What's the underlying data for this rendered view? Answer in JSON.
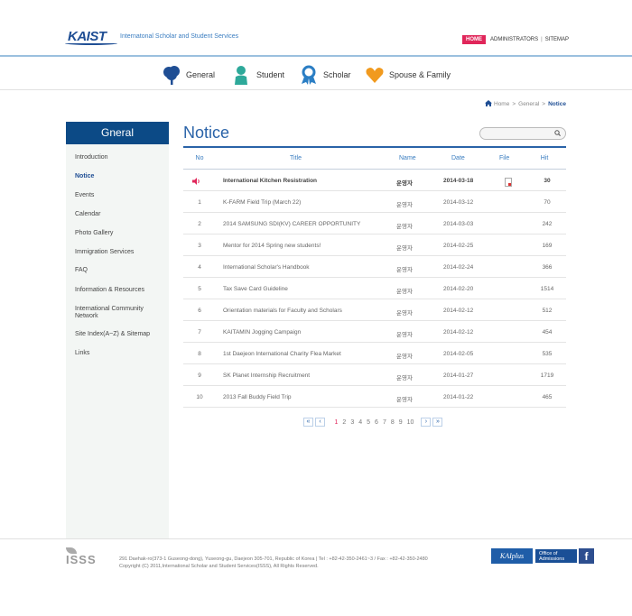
{
  "header": {
    "logo_text": "KAIST",
    "site_name": "Internatonal Scholar and Student Services",
    "home_label": "HOME",
    "administrators_label": "ADMINISTRATORS",
    "sitemap_label": "SITEMAP"
  },
  "nav": {
    "items": [
      {
        "label": "General",
        "icon": "tree-icon",
        "color": "#1f4e94"
      },
      {
        "label": "Student",
        "icon": "person-icon",
        "color": "#2ea99a"
      },
      {
        "label": "Scholar",
        "icon": "award-ribbon-icon",
        "color": "#2b7ec4"
      },
      {
        "label": "Spouse & Family",
        "icon": "heart-icon",
        "color": "#f19a1e"
      }
    ]
  },
  "breadcrumb": {
    "home": "Home",
    "section": "General",
    "current": "Notice"
  },
  "sidebar": {
    "title": "Gneral",
    "items": [
      {
        "label": "Introduction"
      },
      {
        "label": "Notice"
      },
      {
        "label": "Events"
      },
      {
        "label": "Calendar"
      },
      {
        "label": "Photo Gallery"
      },
      {
        "label": "Immigration Services"
      },
      {
        "label": "FAQ"
      },
      {
        "label": "Information & Resources"
      },
      {
        "label": "International Community Network"
      },
      {
        "label": "Site Index(A~Z) & Sitemap"
      },
      {
        "label": "Links"
      }
    ]
  },
  "main": {
    "title": "Notice",
    "columns": {
      "no": "No",
      "title": "Title",
      "name": "Name",
      "date": "Date",
      "file": "File",
      "hit": "Hit"
    },
    "rows": [
      {
        "no": "",
        "title": "International Kitchen Resistration",
        "name": "운영자",
        "date": "2014-03-18",
        "file": true,
        "hit": "30",
        "notice": true
      },
      {
        "no": "1",
        "title": "K-FARM Field Trip (March 22)",
        "name": "운영자",
        "date": "2014-03-12",
        "file": false,
        "hit": "70"
      },
      {
        "no": "2",
        "title": "2014 SAMSUNG SDI(KV) CAREER OPPORTUNITY",
        "name": "운영자",
        "date": "2014-03-03",
        "file": false,
        "hit": "242"
      },
      {
        "no": "3",
        "title": "Mentor for 2014 Spring new students!",
        "name": "운영자",
        "date": "2014-02-25",
        "file": false,
        "hit": "169"
      },
      {
        "no": "4",
        "title": "International Scholar's Handbook",
        "name": "운영자",
        "date": "2014-02-24",
        "file": false,
        "hit": "366"
      },
      {
        "no": "5",
        "title": "Tax Save Card Guideline",
        "name": "운영자",
        "date": "2014-02-20",
        "file": false,
        "hit": "1514"
      },
      {
        "no": "6",
        "title": "Orientation materials for Faculty and Scholars",
        "name": "운영자",
        "date": "2014-02-12",
        "file": false,
        "hit": "512"
      },
      {
        "no": "7",
        "title": "KAITAMIN Jogging Campaign",
        "name": "운영자",
        "date": "2014-02-12",
        "file": false,
        "hit": "454"
      },
      {
        "no": "8",
        "title": "1st Daejeon International Charity Flea Market",
        "name": "운영자",
        "date": "2014-02-05",
        "file": false,
        "hit": "535"
      },
      {
        "no": "9",
        "title": "SK Planet Internship Recruitment",
        "name": "운영자",
        "date": "2014-01-27",
        "file": false,
        "hit": "1719"
      },
      {
        "no": "10",
        "title": "2013 Fall Buddy Field Trip",
        "name": "운영자",
        "date": "2014-01-22",
        "file": false,
        "hit": "465"
      }
    ]
  },
  "pager": {
    "first": "«",
    "prev": "‹",
    "pages": [
      "1",
      "2",
      "3",
      "4",
      "5",
      "6",
      "7",
      "8",
      "9",
      "10"
    ],
    "current": "1",
    "next": "›",
    "last": "»"
  },
  "footer": {
    "logo_text": "ISSS",
    "address": "291 Daehak-ro(373-1 Guseong-dong), Yuseong-gu, Daejeon 305-701, Republic of Korea | Tel : +82-42-350-2461~3 / Fax : +82-42-350-2480",
    "copyright": "Copyright (C) 2011,International Scholar and Student Services(ISSS), All Rights Reserved.",
    "kai_label": "KAIplus",
    "admissions_line1": "Office of",
    "admissions_line2": "Admissions",
    "facebook_label": "f"
  }
}
